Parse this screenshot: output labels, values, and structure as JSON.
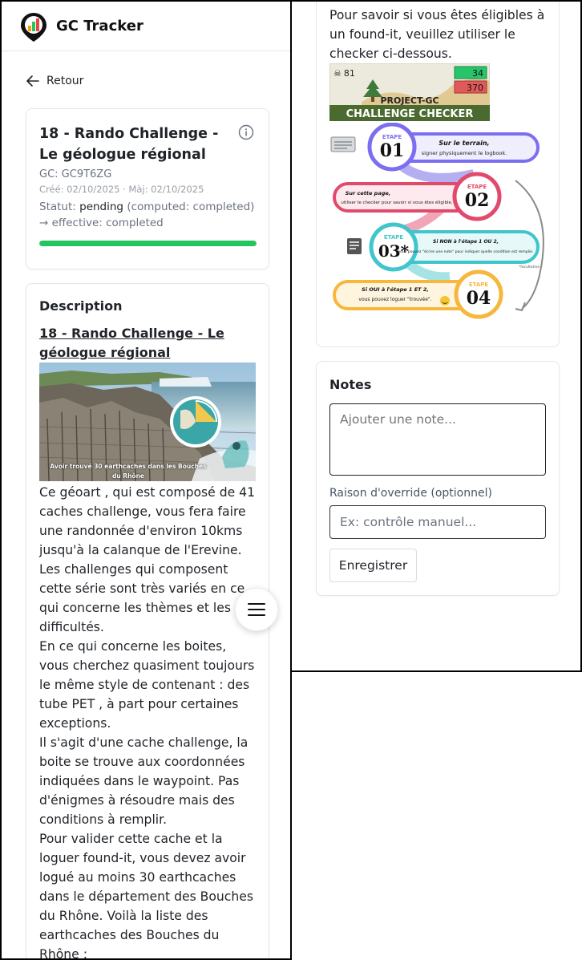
{
  "app": {
    "title": "GC Tracker"
  },
  "nav": {
    "back_label": "Retour"
  },
  "cache": {
    "title": "18 - Rando Challenge - Le géologue régional",
    "gc_code": "GC: GC9T6ZG",
    "dates": "Créé: 02/10/2025 · Màj: 02/10/2025",
    "status_label": "Statut:",
    "status_value": "pending",
    "status_detail": "(computed: completed) → effective: completed",
    "progress": 1.0,
    "progress_color": "#22c55e"
  },
  "description": {
    "heading": "Description",
    "title_link": "18 - Rando Challenge - Le géologue régional",
    "image_caption_line1": "Avoir trouvé 30 earthcaches dans les Bouches",
    "image_caption_line2": "du Rhône",
    "paragraphs": [
      "Ce géoart , qui est composé de 41 caches challenge, vous fera faire une randonnée d'environ 10kms jusqu'à la calanque de l'Erevine. Les challenges qui composent cette série sont très variés en ce qui concerne les thèmes et les difficultés.",
      "En ce qui concerne les boites, vous cherchez quasiment toujours le même style de contenant : des tube PET , à part pour certaines exceptions.",
      "Il s'agit d'une cache challenge, la boite se trouve aux coordonnées indiquées dans le waypoint. Pas d'énigmes à résoudre mais des conditions à remplir.",
      "Pour valider cette cache et la loguer found-it, vous devez avoir logué au moins 30 earthcaches dans le département des Bouches du Rhône. Voilà la liste des earthcaches des Bouches du Rhône : https://coord.info/BMACPRF"
    ]
  },
  "checker": {
    "intro": "Pour savoir si vous êtes éligibles à un found-it, veuillez utiliser le checker ci-dessous.",
    "banner": {
      "count_left": "81",
      "count_green": "34",
      "count_red": "370",
      "brand": "PROJECT-GC",
      "label": "CHALLENGE CHECKER"
    },
    "steps": [
      {
        "tag": "ETAPE",
        "num": "01",
        "text_bold": "Sur le terrain,",
        "text": "signer physiquement le logbook.",
        "color": "#7b6ef0"
      },
      {
        "tag": "ETAPE",
        "num": "02",
        "text_bold": "Sur cette page,",
        "text": "utiliser le checker pour savoir si vous êtes éligible.",
        "color": "#e24a6c"
      },
      {
        "tag": "ETAPE",
        "num": "03*",
        "text_bold": "Si NON à l'étape 1 OU 2,",
        "text": "vous pouvez \"écrire une note\" pour indiquer quelle condition est remplie.",
        "color": "#3fc6cc"
      },
      {
        "tag": "ETAPE",
        "num": "04",
        "text_bold": "Si OUI à l'étape 1 ET 2,",
        "text": "vous pouvez loguer \"trouvée\".",
        "color": "#f6b73c"
      }
    ],
    "footnote": "*facultative"
  },
  "notes": {
    "heading": "Notes",
    "note_placeholder": "Ajouter une note...",
    "override_label": "Raison d'override (optionnel)",
    "override_placeholder": "Ex: contrôle manuel...",
    "save_label": "Enregistrer"
  }
}
